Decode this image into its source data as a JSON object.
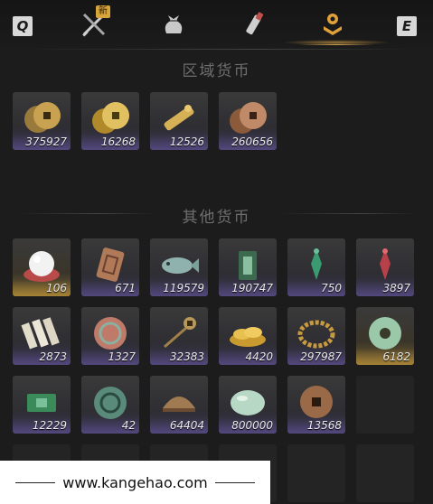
{
  "tabs": {
    "left_key": "Q",
    "right_key": "E",
    "new_badge": "新",
    "items": [
      {
        "icon": "crossed-swords-icon"
      },
      {
        "icon": "pouch-icon"
      },
      {
        "icon": "scroll-brush-icon"
      },
      {
        "icon": "currency-badge-icon",
        "active": true
      }
    ]
  },
  "sections": {
    "regional": {
      "title": "区域货币"
    },
    "other": {
      "title": "其他货币"
    }
  },
  "regional_items": [
    {
      "icon": "copper-coin-stack-icon",
      "count": "375927"
    },
    {
      "icon": "gold-coin-stack-icon",
      "count": "16268"
    },
    {
      "icon": "gold-bar-icon",
      "count": "12526"
    },
    {
      "icon": "bronze-coin-stack-icon",
      "count": "260656"
    }
  ],
  "other_items": [
    {
      "icon": "pearl-icon",
      "count": "106",
      "rarity": "gold"
    },
    {
      "icon": "carved-token-icon",
      "count": "671"
    },
    {
      "icon": "jade-fish-icon",
      "count": "119579"
    },
    {
      "icon": "jade-tablet-icon",
      "count": "190747"
    },
    {
      "icon": "green-pendant-icon",
      "count": "750"
    },
    {
      "icon": "red-pendant-icon",
      "count": "3897"
    },
    {
      "icon": "bamboo-slips-icon",
      "count": "2873"
    },
    {
      "icon": "jade-disc-relief-icon",
      "count": "1327"
    },
    {
      "icon": "coin-string-icon",
      "count": "32383"
    },
    {
      "icon": "gold-ingots-icon",
      "count": "4420"
    },
    {
      "icon": "bead-necklace-icon",
      "count": "297987"
    },
    {
      "icon": "jade-ring-icon",
      "count": "6182",
      "rarity": "gold"
    },
    {
      "icon": "green-banknote-icon",
      "count": "12229"
    },
    {
      "icon": "jade-orb-icon",
      "count": "42"
    },
    {
      "icon": "bronze-bowl-icon",
      "count": "64404"
    },
    {
      "icon": "jade-pebble-icon",
      "count": "800000"
    },
    {
      "icon": "square-hole-coin-icon",
      "count": "13568"
    }
  ],
  "footer": {
    "text": "www.kangehao.com"
  },
  "colors": {
    "accent": "#d0a050",
    "background": "#1c1c1c"
  }
}
